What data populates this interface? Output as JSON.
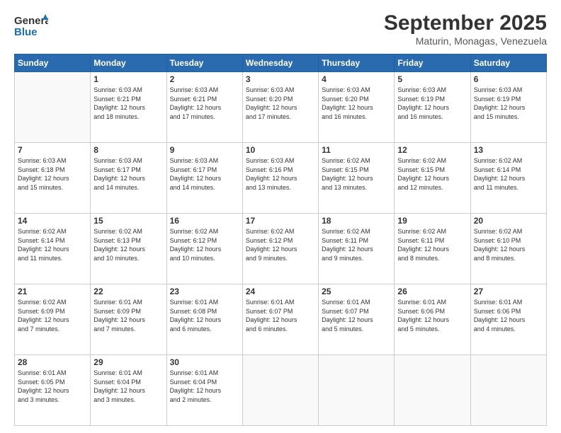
{
  "logo": {
    "line1": "General",
    "line2": "Blue"
  },
  "title": "September 2025",
  "subtitle": "Maturin, Monagas, Venezuela",
  "weekdays": [
    "Sunday",
    "Monday",
    "Tuesday",
    "Wednesday",
    "Thursday",
    "Friday",
    "Saturday"
  ],
  "weeks": [
    [
      {
        "day": "",
        "info": ""
      },
      {
        "day": "1",
        "info": "Sunrise: 6:03 AM\nSunset: 6:21 PM\nDaylight: 12 hours\nand 18 minutes."
      },
      {
        "day": "2",
        "info": "Sunrise: 6:03 AM\nSunset: 6:21 PM\nDaylight: 12 hours\nand 17 minutes."
      },
      {
        "day": "3",
        "info": "Sunrise: 6:03 AM\nSunset: 6:20 PM\nDaylight: 12 hours\nand 17 minutes."
      },
      {
        "day": "4",
        "info": "Sunrise: 6:03 AM\nSunset: 6:20 PM\nDaylight: 12 hours\nand 16 minutes."
      },
      {
        "day": "5",
        "info": "Sunrise: 6:03 AM\nSunset: 6:19 PM\nDaylight: 12 hours\nand 16 minutes."
      },
      {
        "day": "6",
        "info": "Sunrise: 6:03 AM\nSunset: 6:19 PM\nDaylight: 12 hours\nand 15 minutes."
      }
    ],
    [
      {
        "day": "7",
        "info": "Sunrise: 6:03 AM\nSunset: 6:18 PM\nDaylight: 12 hours\nand 15 minutes."
      },
      {
        "day": "8",
        "info": "Sunrise: 6:03 AM\nSunset: 6:17 PM\nDaylight: 12 hours\nand 14 minutes."
      },
      {
        "day": "9",
        "info": "Sunrise: 6:03 AM\nSunset: 6:17 PM\nDaylight: 12 hours\nand 14 minutes."
      },
      {
        "day": "10",
        "info": "Sunrise: 6:03 AM\nSunset: 6:16 PM\nDaylight: 12 hours\nand 13 minutes."
      },
      {
        "day": "11",
        "info": "Sunrise: 6:02 AM\nSunset: 6:15 PM\nDaylight: 12 hours\nand 13 minutes."
      },
      {
        "day": "12",
        "info": "Sunrise: 6:02 AM\nSunset: 6:15 PM\nDaylight: 12 hours\nand 12 minutes."
      },
      {
        "day": "13",
        "info": "Sunrise: 6:02 AM\nSunset: 6:14 PM\nDaylight: 12 hours\nand 11 minutes."
      }
    ],
    [
      {
        "day": "14",
        "info": "Sunrise: 6:02 AM\nSunset: 6:14 PM\nDaylight: 12 hours\nand 11 minutes."
      },
      {
        "day": "15",
        "info": "Sunrise: 6:02 AM\nSunset: 6:13 PM\nDaylight: 12 hours\nand 10 minutes."
      },
      {
        "day": "16",
        "info": "Sunrise: 6:02 AM\nSunset: 6:12 PM\nDaylight: 12 hours\nand 10 minutes."
      },
      {
        "day": "17",
        "info": "Sunrise: 6:02 AM\nSunset: 6:12 PM\nDaylight: 12 hours\nand 9 minutes."
      },
      {
        "day": "18",
        "info": "Sunrise: 6:02 AM\nSunset: 6:11 PM\nDaylight: 12 hours\nand 9 minutes."
      },
      {
        "day": "19",
        "info": "Sunrise: 6:02 AM\nSunset: 6:11 PM\nDaylight: 12 hours\nand 8 minutes."
      },
      {
        "day": "20",
        "info": "Sunrise: 6:02 AM\nSunset: 6:10 PM\nDaylight: 12 hours\nand 8 minutes."
      }
    ],
    [
      {
        "day": "21",
        "info": "Sunrise: 6:02 AM\nSunset: 6:09 PM\nDaylight: 12 hours\nand 7 minutes."
      },
      {
        "day": "22",
        "info": "Sunrise: 6:01 AM\nSunset: 6:09 PM\nDaylight: 12 hours\nand 7 minutes."
      },
      {
        "day": "23",
        "info": "Sunrise: 6:01 AM\nSunset: 6:08 PM\nDaylight: 12 hours\nand 6 minutes."
      },
      {
        "day": "24",
        "info": "Sunrise: 6:01 AM\nSunset: 6:07 PM\nDaylight: 12 hours\nand 6 minutes."
      },
      {
        "day": "25",
        "info": "Sunrise: 6:01 AM\nSunset: 6:07 PM\nDaylight: 12 hours\nand 5 minutes."
      },
      {
        "day": "26",
        "info": "Sunrise: 6:01 AM\nSunset: 6:06 PM\nDaylight: 12 hours\nand 5 minutes."
      },
      {
        "day": "27",
        "info": "Sunrise: 6:01 AM\nSunset: 6:06 PM\nDaylight: 12 hours\nand 4 minutes."
      }
    ],
    [
      {
        "day": "28",
        "info": "Sunrise: 6:01 AM\nSunset: 6:05 PM\nDaylight: 12 hours\nand 3 minutes."
      },
      {
        "day": "29",
        "info": "Sunrise: 6:01 AM\nSunset: 6:04 PM\nDaylight: 12 hours\nand 3 minutes."
      },
      {
        "day": "30",
        "info": "Sunrise: 6:01 AM\nSunset: 6:04 PM\nDaylight: 12 hours\nand 2 minutes."
      },
      {
        "day": "",
        "info": ""
      },
      {
        "day": "",
        "info": ""
      },
      {
        "day": "",
        "info": ""
      },
      {
        "day": "",
        "info": ""
      }
    ]
  ]
}
